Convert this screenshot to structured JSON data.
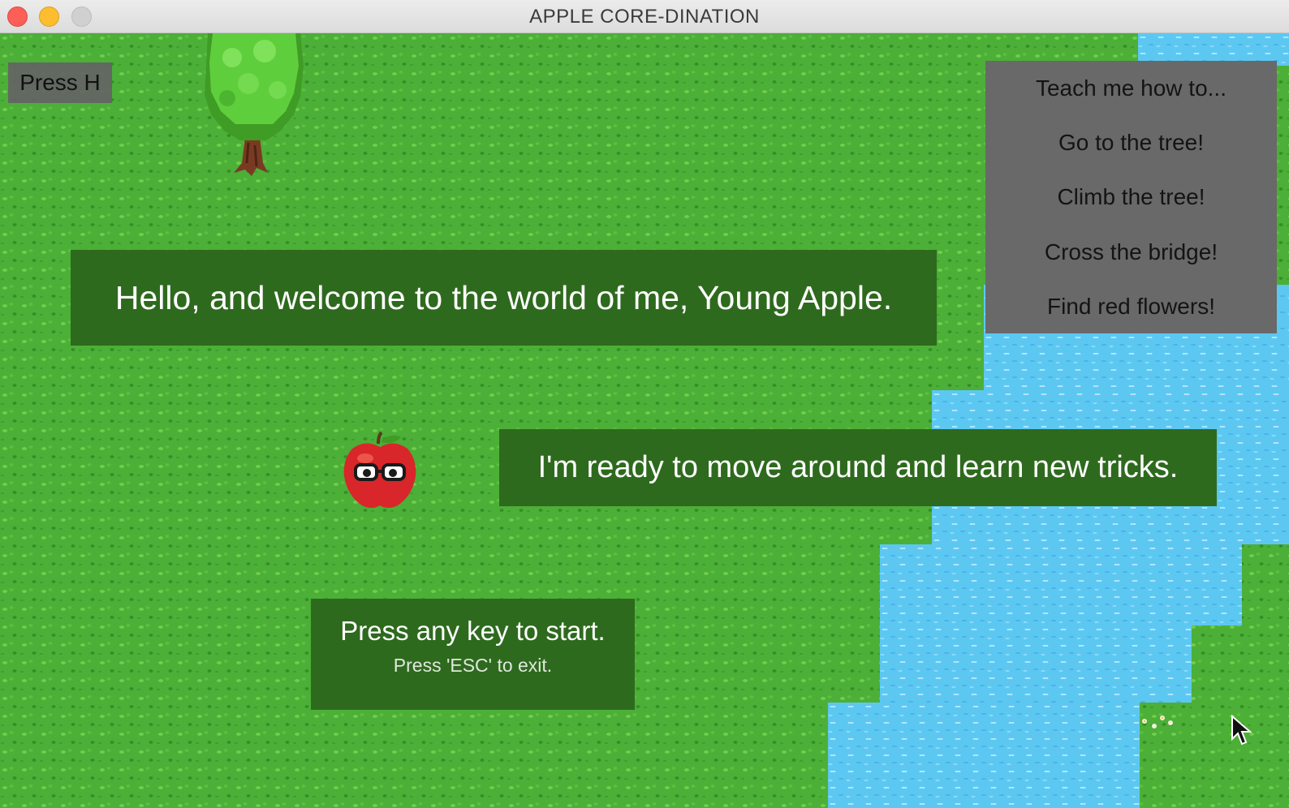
{
  "window": {
    "title": "APPLE CORE-DINATION"
  },
  "hud": {
    "help_hint": "Press H"
  },
  "menu": {
    "items": [
      {
        "label": "Teach me how to..."
      },
      {
        "label": "Go to the tree!"
      },
      {
        "label": "Climb the tree!"
      },
      {
        "label": "Cross the bridge!"
      },
      {
        "label": "Find red flowers!"
      }
    ]
  },
  "dialogs": {
    "welcome": "Hello, and welcome to the world of me, Young Apple.",
    "ready": "I'm ready to move around and learn new tricks.",
    "start": "Press any key to start.",
    "exit": "Press 'ESC' to exit."
  },
  "colors": {
    "grass": "#4caf37",
    "water": "#5cc8f2",
    "dialog_bg": "#2e6a1e",
    "menu_bg": "#696969",
    "hint_bg": "#646464"
  },
  "sprites": [
    "tree-sprite",
    "apple-character-sprite",
    "flowers-sprite",
    "mouse-pointer-icon"
  ]
}
